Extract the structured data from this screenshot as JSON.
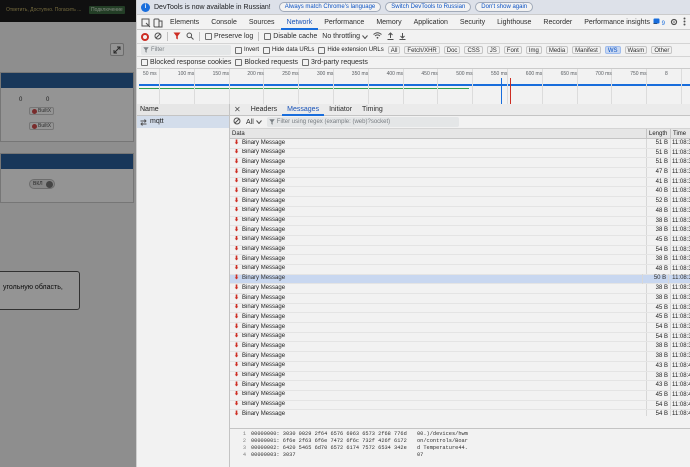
{
  "page": {
    "banner_text": "Ответить, Доступно. Погасить ...",
    "banner_button": "Подключение",
    "card1": {
      "value_a": "0",
      "value_b": "0",
      "chip_1": "BuiltX",
      "chip_2": "BuiltX"
    },
    "card2": {
      "toggle_label": "ВКЛ"
    },
    "tooltip_text": "угольную область,"
  },
  "infobar": {
    "text": "DevTools is now available in Russian!",
    "btn_match": "Always match Chrome's language",
    "btn_switch": "Switch DevTools to Russian",
    "btn_dont": "Don't show again"
  },
  "tabs": [
    "Elements",
    "Console",
    "Sources",
    "Network",
    "Performance",
    "Memory",
    "Application",
    "Security",
    "Lighthouse",
    "Recorder",
    "Performance insights ▲"
  ],
  "active_tab": "Network",
  "issues_count": "9",
  "toolbar": {
    "preserve_log": "Preserve log",
    "disable_cache": "Disable cache",
    "throttling": "No throttling"
  },
  "filter": {
    "placeholder": "Filter",
    "invert": "Invert",
    "hide_data_urls": "Hide data URLs",
    "hide_ext_urls": "Hide extension URLs",
    "types": [
      "All",
      "Fetch/XHR",
      "Doc",
      "CSS",
      "JS",
      "Font",
      "Img",
      "Media",
      "Manifest",
      "WS",
      "Wasm",
      "Other"
    ],
    "active_type": "WS"
  },
  "blocking": {
    "blocked_cookies": "Blocked response cookies",
    "blocked_requests": "Blocked requests",
    "third_party": "3rd-party requests"
  },
  "timeline_ticks": [
    "50 ms",
    "100 ms",
    "150 ms",
    "200 ms",
    "250 ms",
    "300 ms",
    "350 ms",
    "400 ms",
    "450 ms",
    "500 ms",
    "550 ms",
    "600 ms",
    "650 ms",
    "700 ms",
    "750 ms",
    "8"
  ],
  "name_header": "Name",
  "request_name": "mqtt",
  "detail_tabs": [
    "Headers",
    "Messages",
    "Initiator",
    "Timing"
  ],
  "active_detail_tab": "Messages",
  "msg_filter": {
    "select": "All",
    "placeholder": "Filter using regex (example: (web)?socket)"
  },
  "columns": {
    "data": "Data",
    "length": "Length",
    "time": "Time"
  },
  "messages": [
    {
      "data": "Binary Message",
      "length": "51 B",
      "time": "11:08:3"
    },
    {
      "data": "Binary Message",
      "length": "51 B",
      "time": "11:08:3"
    },
    {
      "data": "Binary Message",
      "length": "51 B",
      "time": "11:08:3"
    },
    {
      "data": "Binary Message",
      "length": "47 B",
      "time": "11:08:3"
    },
    {
      "data": "Binary Message",
      "length": "41 B",
      "time": "11:08:3"
    },
    {
      "data": "Binary Message",
      "length": "40 B",
      "time": "11:08:3"
    },
    {
      "data": "Binary Message",
      "length": "52 B",
      "time": "11:08:3"
    },
    {
      "data": "Binary Message",
      "length": "48 B",
      "time": "11:08:3"
    },
    {
      "data": "Binary Message",
      "length": "38 B",
      "time": "11:08:3"
    },
    {
      "data": "Binary Message",
      "length": "38 B",
      "time": "11:08:3"
    },
    {
      "data": "Binary Message",
      "length": "45 B",
      "time": "11:08:3"
    },
    {
      "data": "Binary Message",
      "length": "54 B",
      "time": "11:08:3"
    },
    {
      "data": "Binary Message",
      "length": "38 B",
      "time": "11:08:3"
    },
    {
      "data": "Binary Message",
      "length": "48 B",
      "time": "11:08:3"
    },
    {
      "data": "Binary Message",
      "length": "50 B",
      "time": "11:08:3",
      "selected": true
    },
    {
      "data": "Binary Message",
      "length": "38 B",
      "time": "11:08:3"
    },
    {
      "data": "Binary Message",
      "length": "38 B",
      "time": "11:08:3"
    },
    {
      "data": "Binary Message",
      "length": "45 B",
      "time": "11:08:3"
    },
    {
      "data": "Binary Message",
      "length": "45 B",
      "time": "11:08:3"
    },
    {
      "data": "Binary Message",
      "length": "54 B",
      "time": "11:08:3"
    },
    {
      "data": "Binary Message",
      "length": "54 B",
      "time": "11:08:3"
    },
    {
      "data": "Binary Message",
      "length": "38 B",
      "time": "11:08:3"
    },
    {
      "data": "Binary Message",
      "length": "38 B",
      "time": "11:08:3"
    },
    {
      "data": "Binary Message",
      "length": "43 B",
      "time": "11:08:4"
    },
    {
      "data": "Binary Message",
      "length": "38 B",
      "time": "11:08:4"
    },
    {
      "data": "Binary Message",
      "length": "43 B",
      "time": "11:08:4"
    },
    {
      "data": "Binary Message",
      "length": "45 B",
      "time": "11:08:4"
    },
    {
      "data": "Binary Message",
      "length": "54 B",
      "time": "11:08:4"
    },
    {
      "data": "Binary Message",
      "length": "54 B",
      "time": "11:08:4"
    },
    {
      "data": "Binary Message",
      "length": "45 B",
      "time": "11:08:4"
    }
  ],
  "hex_dump": [
    {
      "line": "1",
      "hex": "00000000: 3030 0029 2f64 6576 6963 6573 2f68 776d",
      "ascii": "00.)/devices/hwm"
    },
    {
      "line": "2",
      "hex": "00000001: 6f6e 2f63 6f6e 7472 6f6c 732f 426f 6172",
      "ascii": "on/controls/Boar"
    },
    {
      "line": "3",
      "hex": "00000002: 6420 5465 6d70 6572 6174 7572 6534 342e",
      "ascii": "d Temperature44."
    },
    {
      "line": "4",
      "hex": "00000003: 3037",
      "ascii": "07"
    }
  ]
}
